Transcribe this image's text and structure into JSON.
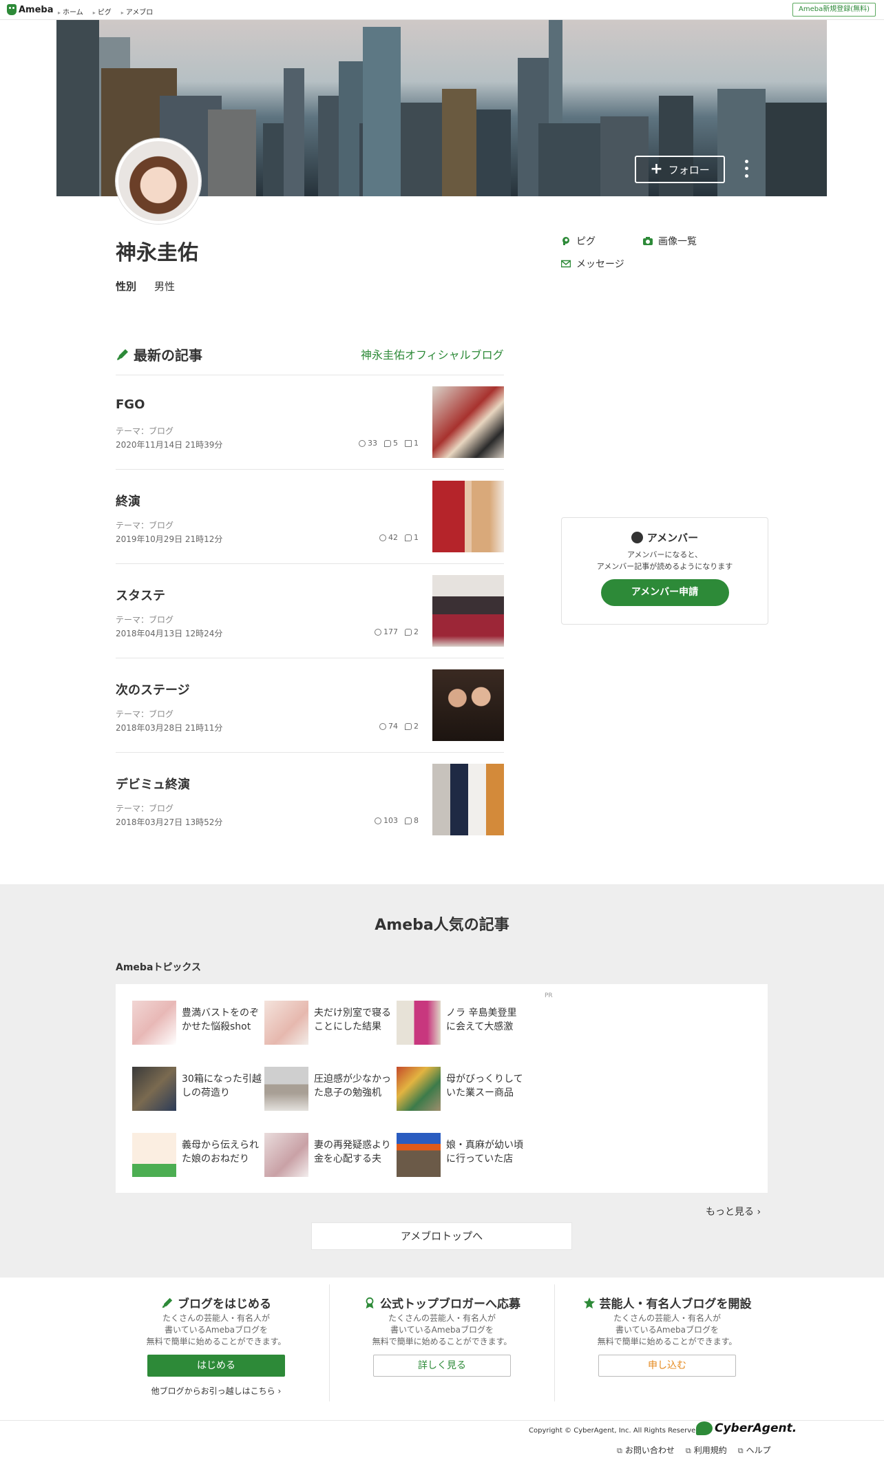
{
  "topbar": {
    "logo": "Ameba",
    "crumbs": [
      "ホーム",
      "ピグ",
      "アメブロ"
    ],
    "register": "Ameba新規登録(無料)"
  },
  "profile": {
    "follow_label": "フォロー",
    "name": "神永圭佑",
    "gender_label": "性別",
    "gender_value": "男性",
    "links": {
      "pigg": "ピグ",
      "images": "画像一覧",
      "message": "メッセージ"
    }
  },
  "latest": {
    "title": "最新の記事",
    "blog_link": "神永圭佑オフィシャルブログ",
    "articles": [
      {
        "title": "FGO",
        "theme": "テーマ：ブログ",
        "date": "2020年11月14日 21時39分",
        "likes": "33",
        "comments": "5",
        "reblogs": "1"
      },
      {
        "title": "終演",
        "theme": "テーマ：ブログ",
        "date": "2019年10月29日 21時12分",
        "likes": "42",
        "comments": "1"
      },
      {
        "title": "スタステ",
        "theme": "テーマ：ブログ",
        "date": "2018年04月13日 12時24分",
        "likes": "177",
        "comments": "2"
      },
      {
        "title": "次のステージ",
        "theme": "テーマ：ブログ",
        "date": "2018年03月28日 21時11分",
        "likes": "74",
        "comments": "2"
      },
      {
        "title": "デビミュ終演",
        "theme": "テーマ：ブログ",
        "date": "2018年03月27日 13時52分",
        "likes": "103",
        "comments": "8"
      }
    ]
  },
  "amember": {
    "title": "アメンバー",
    "desc1": "アメンバーになると、",
    "desc2": "アメンバー記事が読めるようになります",
    "button": "アメンバー申請"
  },
  "popular": {
    "title": "Ameba人気の記事",
    "topics_label": "Amebaトピックス",
    "pr": "PR",
    "topics": [
      "豊満バストをのぞかせた悩殺shot",
      "夫だけ別室で寝ることにした結果",
      "ノラ 辛島美登里に会えて大感激",
      "30箱になった引越しの荷造り",
      "圧迫感が少なかった息子の勉強机",
      "母がびっくりしていた業スー商品",
      "義母から伝えられた娘のおねだり",
      "妻の再発疑惑より金を心配する夫",
      "娘・真麻が幼い頃に行っていた店"
    ],
    "more": "もっと見る",
    "blogtop": "アメブロトップへ"
  },
  "start": {
    "col1": {
      "title": "ブログをはじめる",
      "desc1": "たくさんの芸能人・有名人が",
      "desc2": "書いているAmebaブログを",
      "desc3": "無料で簡単に始めることができます。",
      "button": "はじめる",
      "sub": "他ブログからお引っ越しはこちら"
    },
    "col2": {
      "title": "公式トップブロガーへ応募",
      "desc1": "たくさんの芸能人・有名人が",
      "desc2": "書いているAmebaブログを",
      "desc3": "無料で簡単に始めることができます。",
      "button": "詳しく見る"
    },
    "col3": {
      "title": "芸能人・有名人ブログを開設",
      "desc1": "たくさんの芸能人・有名人が",
      "desc2": "書いているAmebaブログを",
      "desc3": "無料で簡単に始めることができます。",
      "button": "申し込む"
    }
  },
  "footer": {
    "copyright": "Copyright © CyberAgent, Inc. All Rights Reserved.",
    "company": "CyberAgent.",
    "links": [
      "お問い合わせ",
      "利用規約",
      "ヘルプ"
    ]
  },
  "colors": {
    "accent": "#2d8a38",
    "orange": "#e58a1f",
    "gray_bg": "#eeeeee"
  }
}
